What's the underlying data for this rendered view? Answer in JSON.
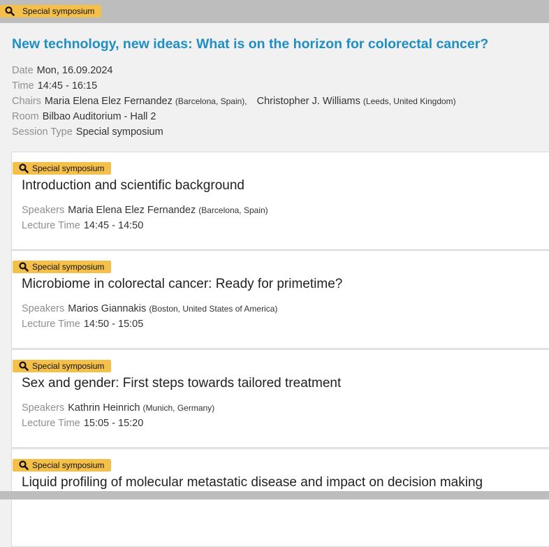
{
  "session": {
    "tag": "Special symposium",
    "title": "New technology, new ideas: What is on the horizon for colorectal cancer?",
    "date_label": "Date",
    "date": "Mon, 16.09.2024",
    "time_label": "Time",
    "time": "14:45 - 16:15",
    "chairs_label": "Chairs",
    "chairs": [
      {
        "name": "Maria Elena Elez Fernandez",
        "location": "(Barcelona, Spain),"
      },
      {
        "name": "Christopher J. Williams",
        "location": "(Leeds, United Kingdom)"
      }
    ],
    "room_label": "Room",
    "room": "Bilbao Auditorium - Hall 2",
    "type_label": "Session Type",
    "type": "Special symposium"
  },
  "lectures": [
    {
      "tag": "Special symposium",
      "title": "Introduction and scientific background",
      "speakers_label": "Speakers",
      "speaker": "Maria Elena Elez Fernandez",
      "location": "(Barcelona, Spain)",
      "time_label": "Lecture Time",
      "time": "14:45 - 14:50"
    },
    {
      "tag": "Special symposium",
      "title": "Microbiome in colorectal cancer: Ready for primetime?",
      "speakers_label": "Speakers",
      "speaker": "Marios Giannakis",
      "location": "(Boston, United States of America)",
      "time_label": "Lecture Time",
      "time": "14:50 - 15:05"
    },
    {
      "tag": "Special symposium",
      "title": "Sex and gender: First steps towards tailored treatment",
      "speakers_label": "Speakers",
      "speaker": "Kathrin Heinrich",
      "location": "(Munich, Germany)",
      "time_label": "Lecture Time",
      "time": "15:05 - 15:20"
    },
    {
      "tag": "Special symposium",
      "title": "Liquid profiling of molecular metastatic disease and impact on decision making"
    }
  ],
  "colors": {
    "tag_bg": "#f5c04a",
    "title_blue": "#1f8ec4",
    "label_gray": "#8f8f8f",
    "top_bar": "#bdbdbd"
  },
  "icons": {
    "tag_icon": "search-icon"
  }
}
